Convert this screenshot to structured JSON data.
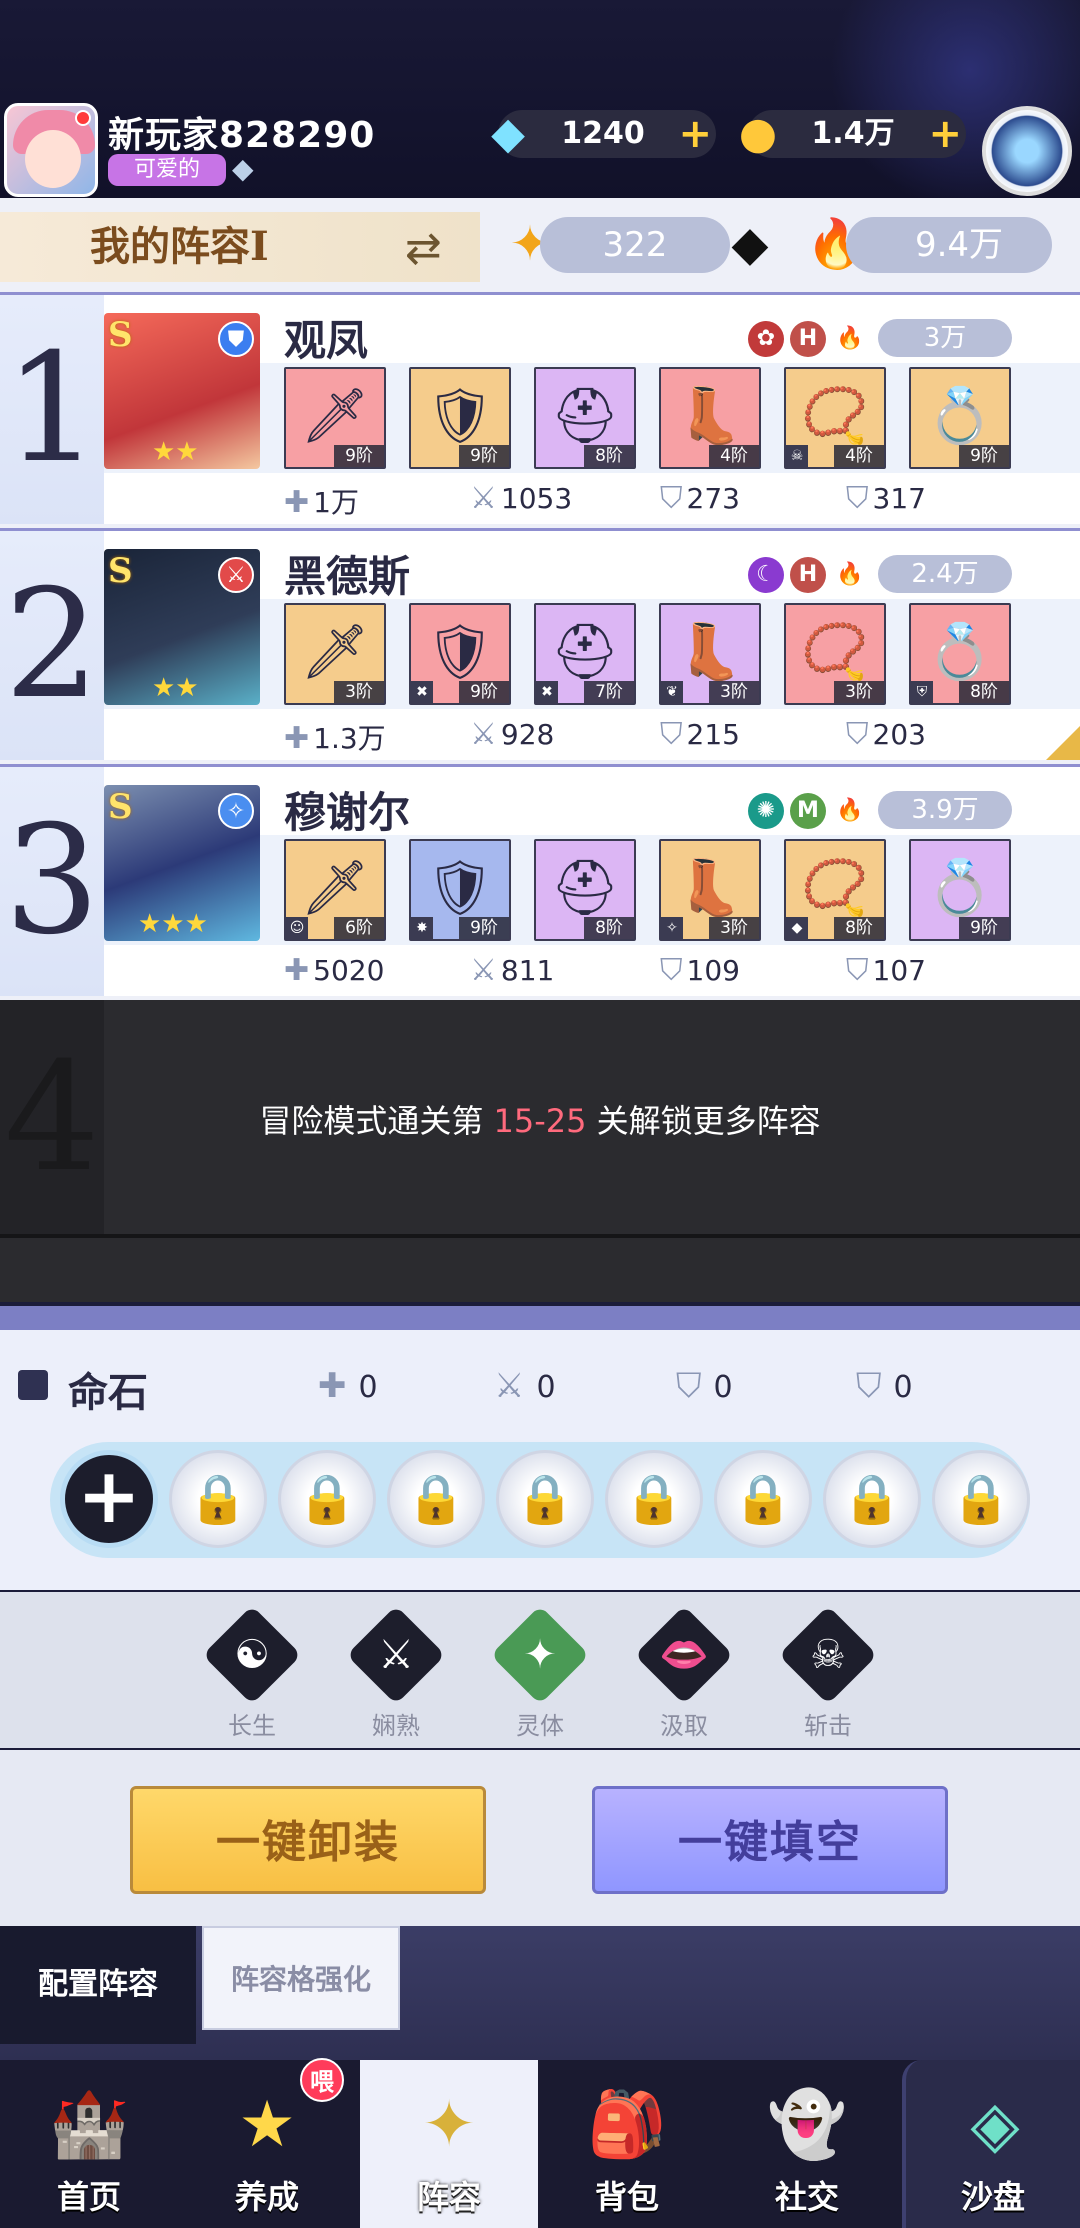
{
  "player": {
    "name": "新玩家828290",
    "title": "可爱的"
  },
  "currency": {
    "diamonds": "1240",
    "coins": "1.4万"
  },
  "lineup_header": {
    "title": "我的阵容Ⅰ",
    "stat1": "322",
    "power": "9.4万"
  },
  "teams": [
    {
      "number": "1",
      "rank": "S",
      "name": "观凤",
      "power": "3万",
      "stars": "★★",
      "equips": [
        "9阶",
        "9阶",
        "8阶",
        "4阶",
        "4阶",
        "9阶"
      ],
      "stats": {
        "hp": "1万",
        "atk": "1053",
        "def": "273",
        "mdef": "317"
      }
    },
    {
      "number": "2",
      "rank": "S",
      "name": "黑德斯",
      "power": "2.4万",
      "stars": "★★",
      "equips": [
        "3阶",
        "9阶",
        "7阶",
        "3阶",
        "3阶",
        "8阶"
      ],
      "stats": {
        "hp": "1.3万",
        "atk": "928",
        "def": "215",
        "mdef": "203"
      }
    },
    {
      "number": "3",
      "rank": "S",
      "name": "穆谢尔",
      "power": "3.9万",
      "stars": "★★★",
      "equips": [
        "6阶",
        "9阶",
        "8阶",
        "3阶",
        "8阶",
        "9阶"
      ],
      "stats": {
        "hp": "5020",
        "atk": "811",
        "def": "109",
        "mdef": "107"
      }
    }
  ],
  "locked_slot": {
    "number": "4",
    "msg_pre": "冒险模式通关第 ",
    "msg_stage": "15-25",
    "msg_post": " 关解锁更多阵容"
  },
  "fate_stone": {
    "title": "命石",
    "hp": "0",
    "atk": "0",
    "def": "0",
    "mdef": "0"
  },
  "skills": [
    "长生",
    "娴熟",
    "灵体",
    "汲取",
    "斩击"
  ],
  "buttons": {
    "unequip": "一键卸装",
    "fill": "一键填空"
  },
  "tabs": {
    "config": "配置阵容",
    "enhance": "阵容格强化"
  },
  "nav": [
    "首页",
    "养成",
    "阵容",
    "背包",
    "社交",
    "沙盘"
  ],
  "nav_badge": "喂",
  "colors": {
    "accent_gold": "#f8bf43",
    "accent_blue": "#8f96ff",
    "highlight_red": "#ff6a7d"
  }
}
